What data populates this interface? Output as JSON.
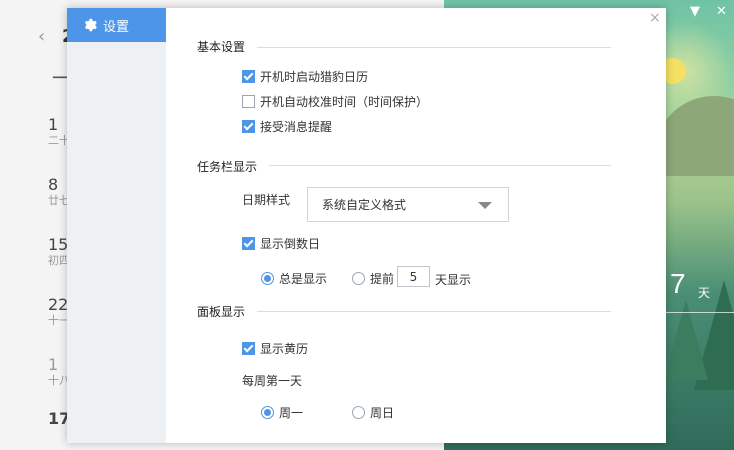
{
  "background_calendar": {
    "back_arrow": "‹",
    "header_partial": "2",
    "week_mark": "一",
    "dates": [
      {
        "num": "1",
        "lunar": "二十"
      },
      {
        "num": "8",
        "lunar": "廿七"
      },
      {
        "num": "15",
        "lunar": "初四"
      },
      {
        "num": "22",
        "lunar": "十一"
      },
      {
        "num": "1",
        "lunar": "十八"
      },
      {
        "num": "17",
        "lunar": ""
      }
    ]
  },
  "background_scene": {
    "day_number": "7",
    "day_unit": "天",
    "ctrl_pin": "▼",
    "ctrl_close": "✕"
  },
  "dialog": {
    "sidebar": {
      "settings_label": "设置"
    },
    "close_icon": "×",
    "basic": {
      "title": "基本设置",
      "autostart": "开机时启动猎豹日历",
      "auto_time_sync": "开机自动校准时间（时间保护）",
      "accept_reminders": "接受消息提醒"
    },
    "taskbar": {
      "title": "任务栏显示",
      "date_style_label": "日期样式",
      "date_style_value": "系统自定义格式",
      "show_countdown": "显示倒数日",
      "always_show": "总是显示",
      "ahead_prefix": "提前",
      "ahead_days": "5",
      "ahead_suffix": "天显示"
    },
    "panel": {
      "title": "面板显示",
      "show_almanac": "显示黄历",
      "week_start_label": "每周第一天",
      "monday": "周一",
      "sunday": "周日"
    }
  },
  "state": {
    "autostart": true,
    "auto_time_sync": false,
    "accept_reminders": true,
    "show_countdown": true,
    "countdown_mode": "always",
    "show_almanac": true,
    "week_start": "monday"
  },
  "colors": {
    "accent": "#4d95e8",
    "sidebar_bg": "#eef1f4"
  }
}
